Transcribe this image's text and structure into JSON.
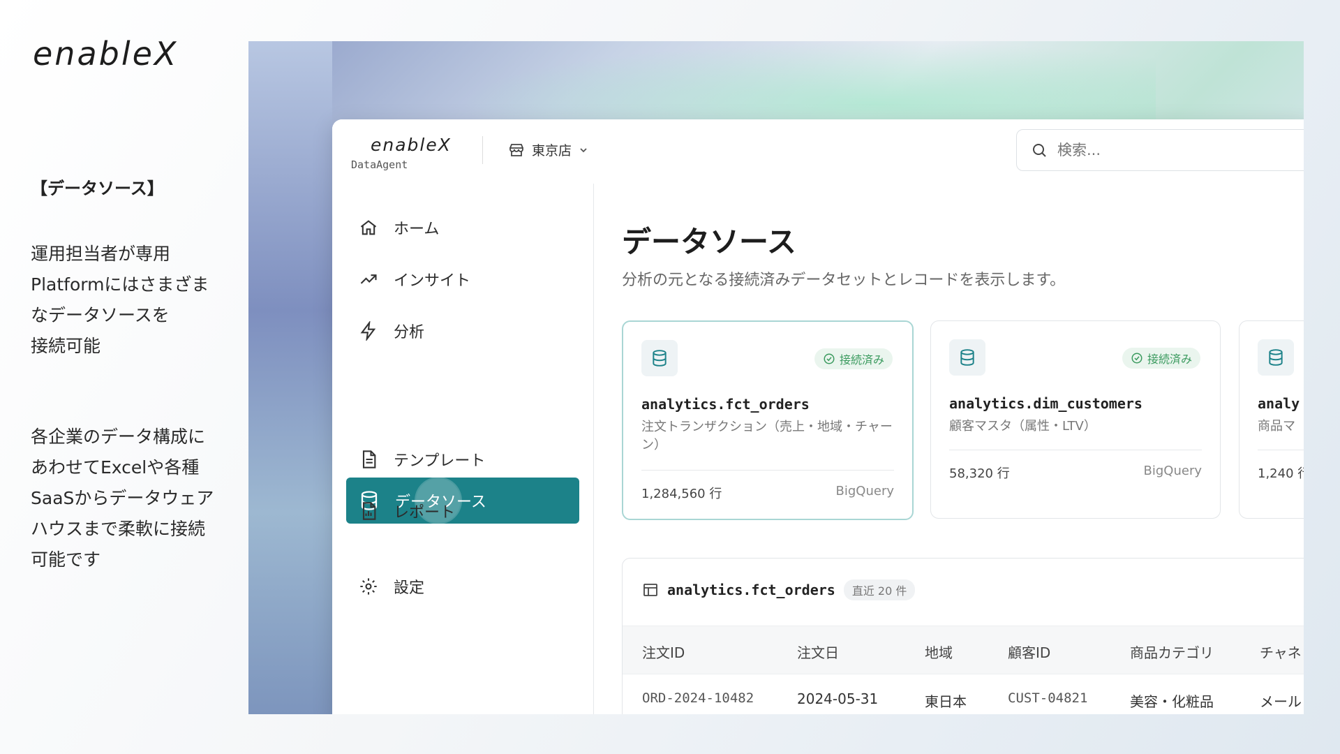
{
  "slide": {
    "brand": "enableX",
    "section_title": "【データソース】",
    "description_1": "運用担当者が専用\nPlatformにはさまざま\nなデータソースを\n接続可能",
    "description_2": "各企業のデータ構成に\nあわせてExcelや各種\nSaaSからデータウェア\nハウスまで柔軟に接続\n可能です"
  },
  "app": {
    "logo": "enableX",
    "logo_sub": "DataAgent",
    "store": "東京店",
    "search_placeholder": "検索..."
  },
  "sidebar": {
    "items": [
      {
        "label": "ホーム",
        "icon": "home-icon"
      },
      {
        "label": "インサイト",
        "icon": "trend-icon"
      },
      {
        "label": "分析",
        "icon": "bolt-icon"
      },
      {
        "label": "データソース",
        "icon": "database-icon",
        "active": true
      },
      {
        "label": "テンプレート",
        "icon": "document-icon"
      },
      {
        "label": "レポート",
        "icon": "report-icon"
      },
      {
        "label": "設定",
        "icon": "gear-icon"
      }
    ]
  },
  "main": {
    "title": "データソース",
    "subtitle": "分析の元となる接続済みデータセットとレコードを表示します。",
    "cards": [
      {
        "name": "analytics.fct_orders",
        "desc": "注文トランザクション（売上・地域・チャーン）",
        "badge": "接続済み",
        "rows": "1,284,560 行",
        "source": "BigQuery"
      },
      {
        "name": "analytics.dim_customers",
        "desc": "顧客マスタ（属性・LTV）",
        "badge": "接続済み",
        "rows": "58,320 行",
        "source": "BigQuery"
      },
      {
        "name": "analy",
        "desc": "商品マ",
        "rows": "1,240 行"
      }
    ],
    "table": {
      "name": "analytics.fct_orders",
      "count": "直近 20 件",
      "headers": [
        "注文ID",
        "注文日",
        "地域",
        "顧客ID",
        "商品カテゴリ",
        "チャネ"
      ],
      "rows": [
        [
          "ORD-2024-10482",
          "2024-05-31",
          "東日本",
          "CUST-04821",
          "美容・化粧品",
          "メール"
        ]
      ]
    }
  },
  "colors": {
    "accent": "#1c8289",
    "connected": "#3a9a5e"
  }
}
